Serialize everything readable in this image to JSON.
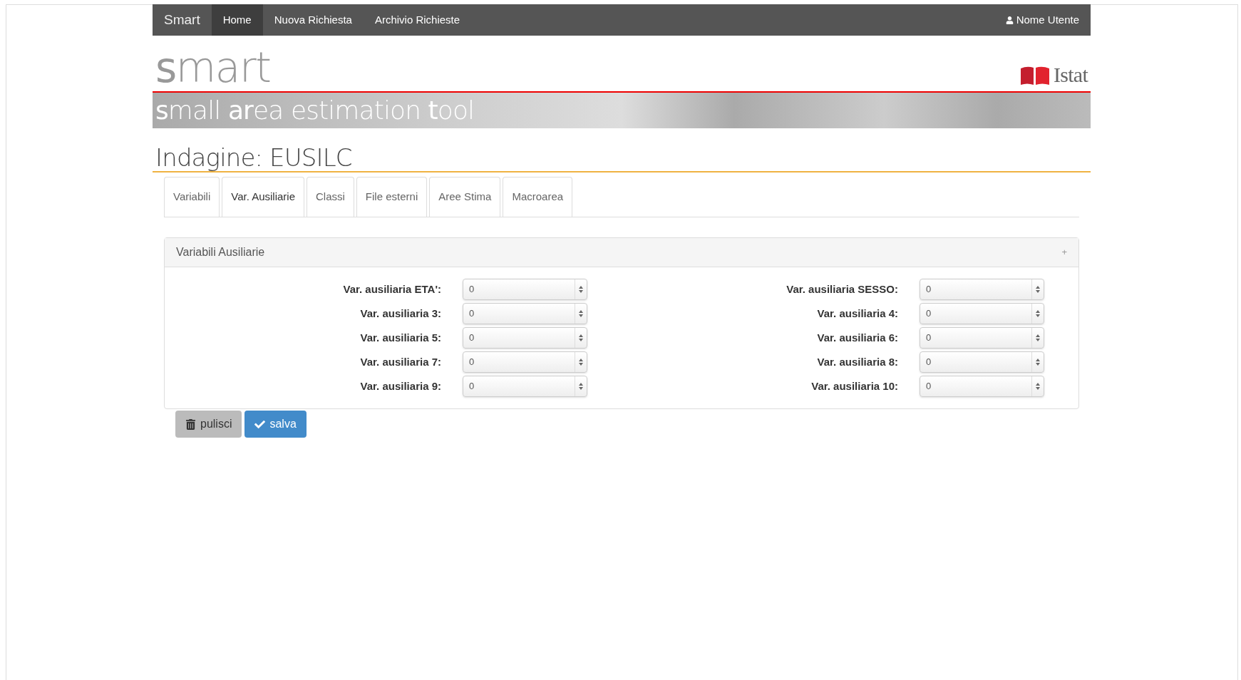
{
  "navbar": {
    "brand": "Smart",
    "items": [
      {
        "label": "Home",
        "selected": true
      },
      {
        "label": "Nuova Richiesta",
        "selected": false
      },
      {
        "label": "Archivio Richieste",
        "selected": false
      }
    ],
    "user": "Nome Utente"
  },
  "header": {
    "logo": "**s**mart",
    "org": "Istat",
    "banner": "**s**mall **ar**ea estimation **t**ool"
  },
  "page_title": "Indagine: EUSILC",
  "tabs": [
    {
      "label": "Variabili",
      "selected": false
    },
    {
      "label": "Var. Ausiliarie",
      "selected": true
    },
    {
      "label": "Classi",
      "selected": false
    },
    {
      "label": "File esterni",
      "selected": false
    },
    {
      "label": "Aree Stima",
      "selected": false
    },
    {
      "label": "Macroarea",
      "selected": false
    }
  ],
  "panel": {
    "title": "Variabili Ausiliarie",
    "toggle": "+",
    "fields": [
      {
        "label": "Var. ausiliaria ETA':",
        "value": "0"
      },
      {
        "label": "Var. ausiliaria SESSO:",
        "value": "0"
      },
      {
        "label": "Var. ausiliaria 3:",
        "value": "0"
      },
      {
        "label": "Var. ausiliaria 4:",
        "value": "0"
      },
      {
        "label": "Var. ausiliaria 5:",
        "value": "0"
      },
      {
        "label": "Var. ausiliaria 6:",
        "value": "0"
      },
      {
        "label": "Var. ausiliaria 7:",
        "value": "0"
      },
      {
        "label": "Var. ausiliaria 8:",
        "value": "0"
      },
      {
        "label": "Var. ausiliaria 9:",
        "value": "0"
      },
      {
        "label": "Var. ausiliaria 10:",
        "value": "0"
      }
    ]
  },
  "buttons": [
    {
      "label": "pulisci",
      "kind": "clear"
    },
    {
      "label": "salva",
      "kind": "save"
    }
  ]
}
